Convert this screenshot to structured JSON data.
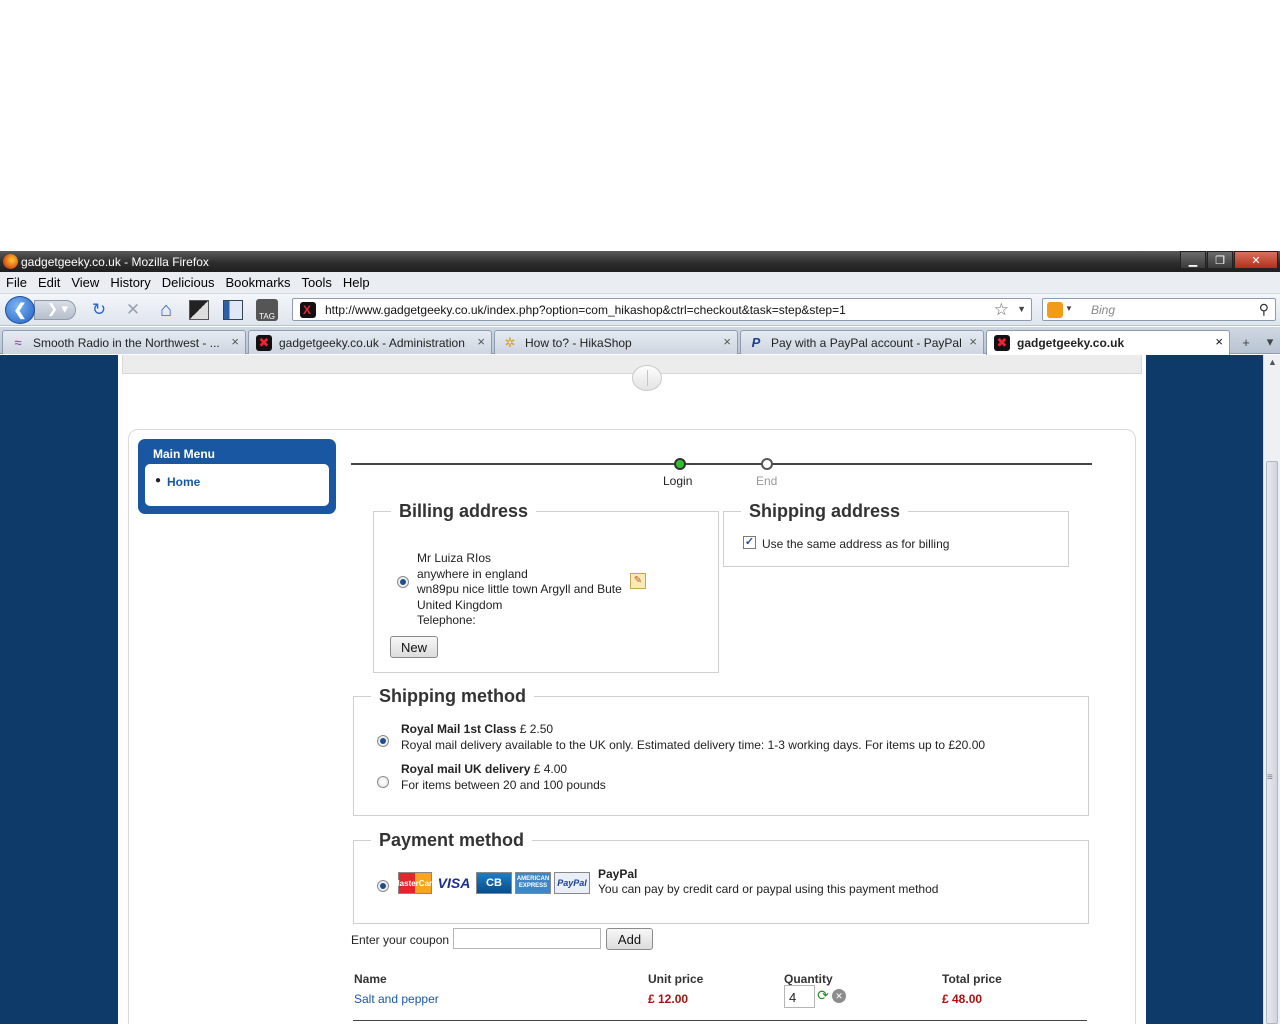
{
  "window": {
    "title": "gadgetgeeky.co.uk - Mozilla Firefox",
    "minimize": "▁",
    "maximize": "❐",
    "close": "✕"
  },
  "menubar": [
    "File",
    "Edit",
    "View",
    "History",
    "Delicious",
    "Bookmarks",
    "Tools",
    "Help"
  ],
  "navbar": {
    "back": "❮",
    "forward": "❯ ▾",
    "reload": "↻",
    "stop": "✕",
    "home": "⌂",
    "url": "http://www.gadgetgeeky.co.uk/index.php?option=com_hikashop&ctrl=checkout&task=step&step=1",
    "bookmark_star": "☆",
    "url_dropdown": "▼",
    "search_placeholder": "Bing",
    "search_dropdown": "▼",
    "search_glass": "⚲",
    "tag_label": "TAG"
  },
  "tabs": [
    {
      "label": "Smooth Radio in the Northwest - ...",
      "icon": "≈",
      "close": "×"
    },
    {
      "label": "gadgetgeeky.co.uk - Administration",
      "icon": "✖",
      "close": "×"
    },
    {
      "label": "How to? - HikaShop",
      "icon": "✲",
      "close": "×"
    },
    {
      "label": "Pay with a PayPal account - PayPal",
      "icon": "P",
      "close": "×"
    },
    {
      "label": "gadgetgeeky.co.uk",
      "icon": "✖",
      "close": "×"
    }
  ],
  "tab_extras": {
    "new_tab": "+",
    "list": "▾"
  },
  "scrollbar": {
    "up_arrow": "▲",
    "grip": "≡"
  },
  "sidebar": {
    "title": "Main Menu",
    "bullet": "●",
    "items": [
      "Home"
    ]
  },
  "steps": [
    "Login",
    "End"
  ],
  "billing": {
    "legend": "Billing address",
    "lines": [
      "Mr Luiza RIos",
      "anywhere in england",
      "wn89pu nice little town Argyll and Bute",
      "United Kingdom",
      "Telephone:"
    ],
    "edit_icon": "✎",
    "new_button": "New"
  },
  "shipping_address": {
    "legend": "Shipping address",
    "checkbox_mark": "✓",
    "checkbox_label": "Use the same address as for billing"
  },
  "shipping_method": {
    "legend": "Shipping method",
    "options": [
      {
        "name": "Royal Mail 1st Class",
        "price": "£ 2.50",
        "desc": "Royal mail delivery available to the UK only. Estimated delivery time: 1-3 working days. For items up to £20.00"
      },
      {
        "name": "Royal mail UK delivery",
        "price": "£ 4.00",
        "desc": "For items between 20 and 100 pounds"
      }
    ]
  },
  "payment_method": {
    "legend": "Payment method",
    "name": "PayPal",
    "desc": "You can pay by credit card or paypal using this payment method",
    "cards": [
      "MasterCard",
      "VISA",
      "CB",
      "AMERICAN EXPRESS",
      "PayPal"
    ]
  },
  "coupon": {
    "label": "Enter your coupon",
    "button": "Add"
  },
  "cart": {
    "headers": [
      "Name",
      "Unit price",
      "Quantity",
      "Total price"
    ],
    "rows": [
      {
        "name": "Salt and pepper",
        "unit_price": "£ 12.00",
        "quantity": "4",
        "total_price": "£ 48.00"
      }
    ],
    "refresh_icon": "⟳",
    "remove_icon": "✕"
  },
  "colors": {
    "page_background": "#0d3a69",
    "menu_blue": "#1a57a3",
    "price_red": "#a11111",
    "step_done": "#2fc02f"
  }
}
